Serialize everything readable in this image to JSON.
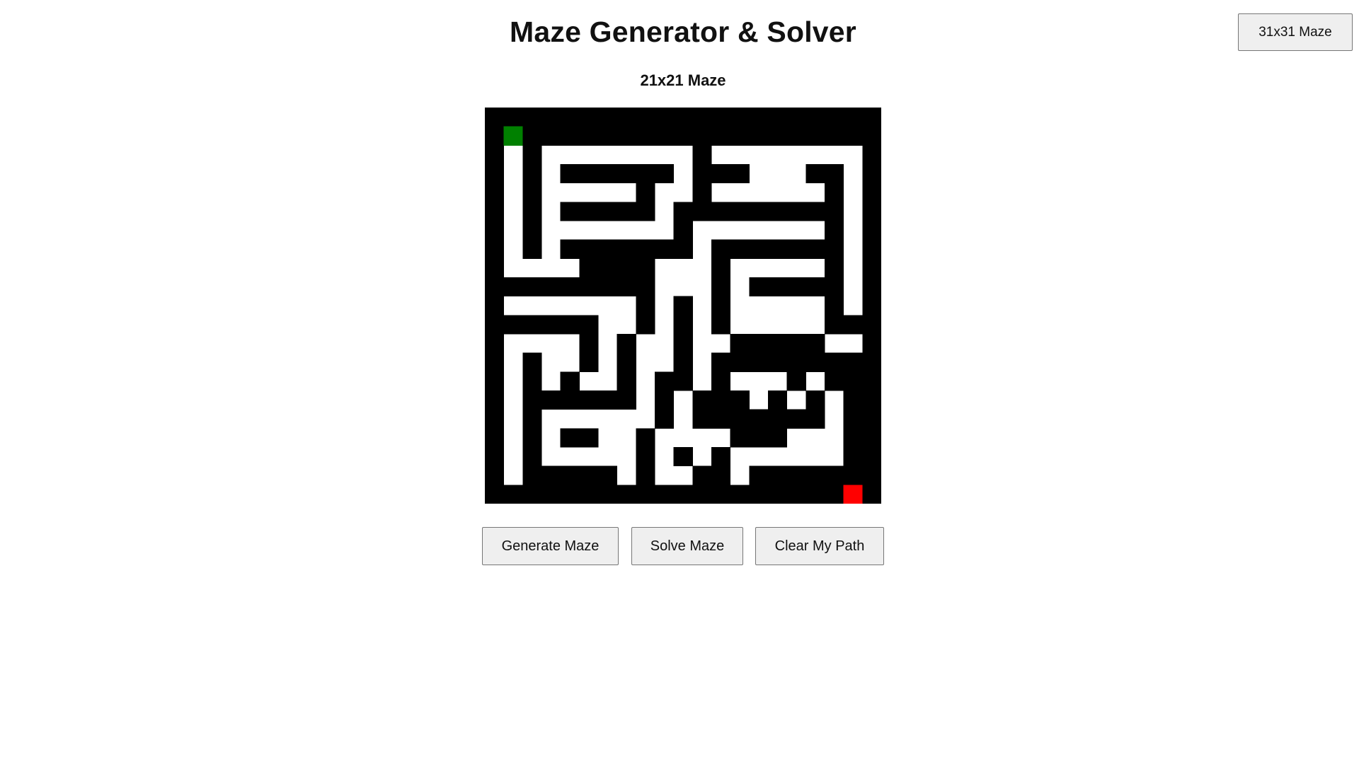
{
  "header": {
    "title": "Maze Generator & Solver",
    "size_toggle_label": "31x31 Maze"
  },
  "maze": {
    "label": "21x21 Maze",
    "rows": 21,
    "cols": 21,
    "colors": {
      "wall": "#000000",
      "path": "#ffffff",
      "start": "#008000",
      "end": "#ff0000"
    },
    "start_cell": [
      1,
      1
    ],
    "end_cell": [
      20,
      19
    ],
    "grid": [
      "111111111111111111111",
      "101111111111111111111",
      "101000000001000000001",
      "101011111101110001101",
      "101000001001000000101",
      "101011111011111111101",
      "101000000010000000101",
      "101011111110111111101",
      "100001111000100000101",
      "111111111000101111101",
      "100000001010100000101",
      "111111001010100000111",
      "100001010010011111001",
      "101001010010111111111",
      "101010010110100010111",
      "101111110101110101011",
      "101000000101111111011",
      "101011001000011100011",
      "101000001010100000011",
      "101111101001101111111",
      "111111111111111111111"
    ]
  },
  "controls": {
    "generate_label": "Generate Maze",
    "solve_label": "Solve Maze",
    "clear_label": "Clear My Path"
  }
}
